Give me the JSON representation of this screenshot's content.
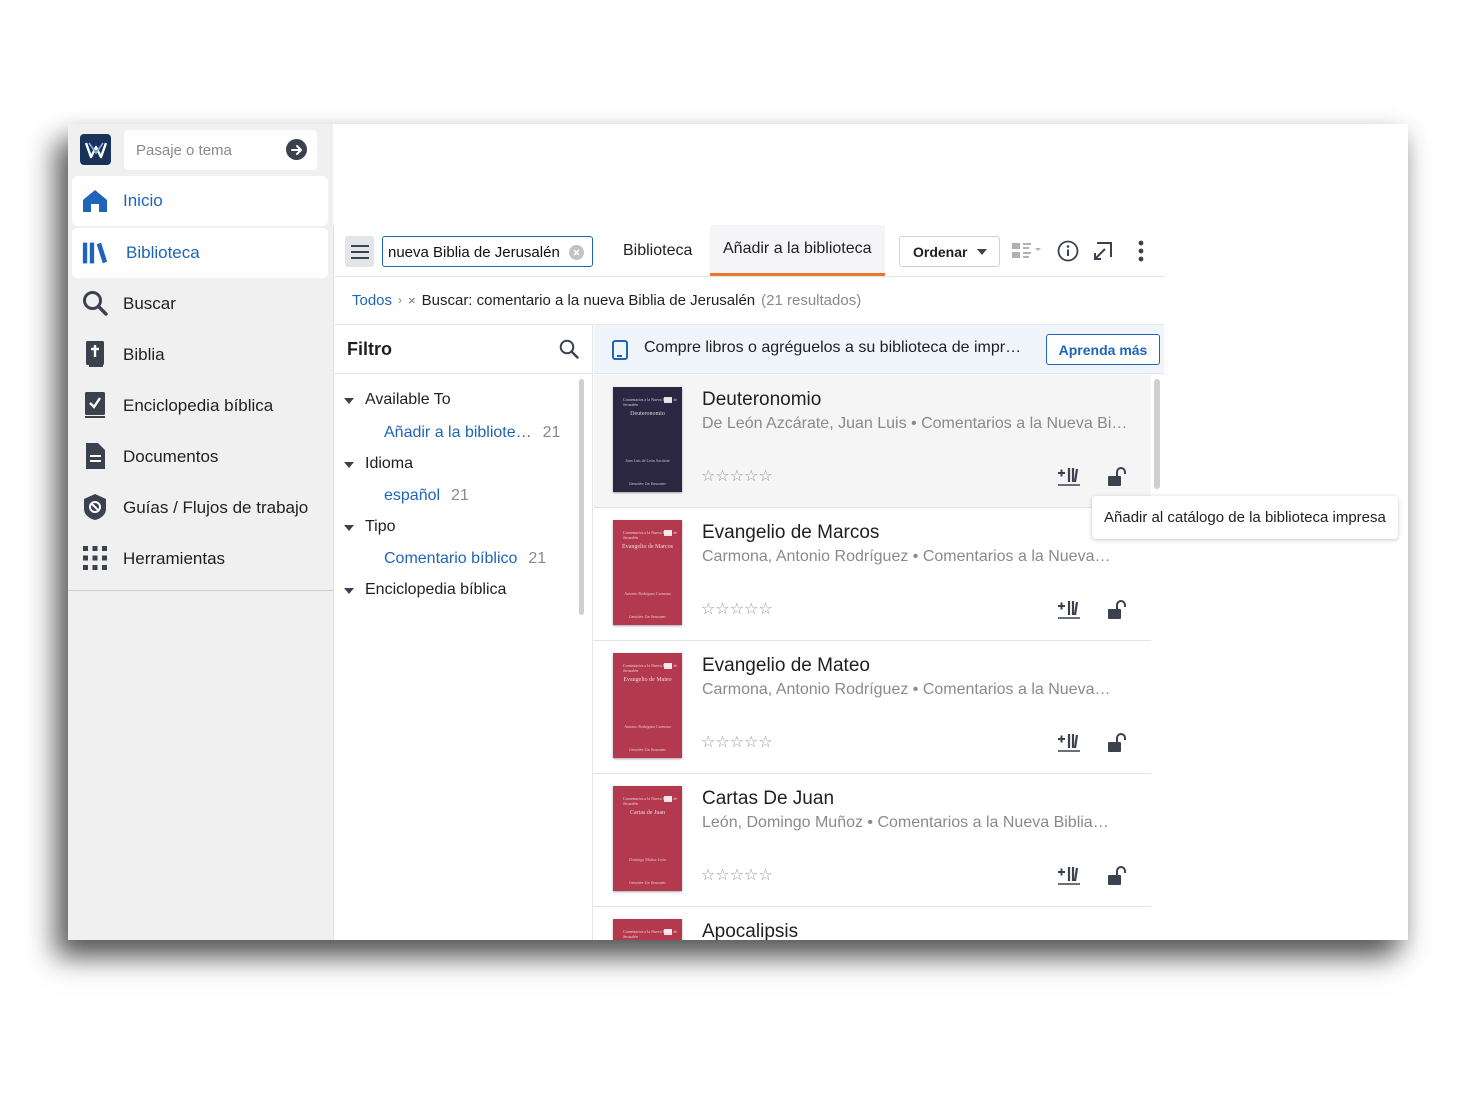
{
  "sidebar": {
    "passage_placeholder": "Pasaje o tema",
    "items": [
      {
        "label": "Inicio",
        "icon": "home-icon",
        "active": true
      },
      {
        "label": "Biblioteca",
        "icon": "library-icon",
        "active": true
      },
      {
        "label": "Buscar",
        "icon": "search-icon"
      },
      {
        "label": "Biblia",
        "icon": "bible-icon"
      },
      {
        "label": "Enciclopedia bíblica",
        "icon": "encyclopedia-icon"
      },
      {
        "label": "Documentos",
        "icon": "document-icon"
      },
      {
        "label": "Guías / Flujos de trabajo",
        "icon": "guides-icon"
      },
      {
        "label": "Herramientas",
        "icon": "tools-grid-icon"
      }
    ]
  },
  "toolbar": {
    "search_value": "nueva Biblia de Jerusalén",
    "tabs": [
      {
        "label": "Biblioteca"
      },
      {
        "label": "Añadir a la biblioteca",
        "active": true
      }
    ],
    "sort_label": "Ordenar"
  },
  "breadcrumb": {
    "root": "Todos",
    "current": "Buscar: comentario a la nueva Biblia de Jerusalén",
    "count": "(21 resultados)"
  },
  "filter": {
    "title": "Filtro",
    "groups": [
      {
        "label": "Available To",
        "items": [
          {
            "label": "Añadir a la bibliote…",
            "count": "21"
          }
        ]
      },
      {
        "label": "Idioma",
        "items": [
          {
            "label": "español",
            "count": "21"
          }
        ]
      },
      {
        "label": "Tipo",
        "items": [
          {
            "label": "Comentario bíblico",
            "count": "21"
          }
        ]
      },
      {
        "label": "Enciclopedia bíblica",
        "items": []
      }
    ]
  },
  "promo": {
    "text": "Compre libros o agréguelos a su biblioteca de impr…",
    "button": "Aprenda más"
  },
  "results": [
    {
      "title": "Deuteronomio",
      "subtitle": "De León Azcárate, Juan Luis • Comentarios a la Nueva Bi…",
      "rating": "☆☆☆☆☆",
      "cover_color": "#2b2743",
      "cover_top": "Comentarios a la Nueva Biblia de Jerusalén",
      "cover_name": "Deuteronomio",
      "cover_author": "Juan Luis de León Azcárate",
      "cover_publisher": "Desclée De Brouwer"
    },
    {
      "title": "Evangelio de Marcos",
      "subtitle": "Carmona, Antonio Rodríguez • Comentarios a la Nueva…",
      "rating": "☆☆☆☆☆",
      "cover_color": "#b3394e",
      "cover_top": "Comentarios a la Nueva Biblia de Jerusalén",
      "cover_name": "Evangelio de Marcos",
      "cover_author": "Antonio Rodríguez Carmona",
      "cover_publisher": "Desclée De Brouwer"
    },
    {
      "title": "Evangelio de Mateo",
      "subtitle": "Carmona, Antonio Rodríguez • Comentarios a la Nueva…",
      "rating": "☆☆☆☆☆",
      "cover_color": "#b3394e",
      "cover_top": "Comentarios a la Nueva Biblia de Jerusalén",
      "cover_name": "Evangelio de Mateo",
      "cover_author": "Antonio Rodríguez Carmona",
      "cover_publisher": "Desclée De Brouwer"
    },
    {
      "title": "Cartas De Juan",
      "subtitle": "León, Domingo Muñoz • Comentarios a la Nueva Biblia…",
      "rating": "☆☆☆☆☆",
      "cover_color": "#b3394e",
      "cover_top": "Comentarios a la Nueva Biblia de Jerusalén",
      "cover_name": "Cartas de Juan",
      "cover_author": "Domingo Muñoz León",
      "cover_publisher": "Desclée De Brouwer"
    },
    {
      "title": "Apocalipsis",
      "subtitle": "",
      "rating": "",
      "cover_color": "#b3394e",
      "cover_top": "Comentarios a la Nueva Biblia de Jerusalén",
      "cover_name": "",
      "cover_author": "",
      "cover_publisher": ""
    }
  ],
  "tooltip": "Añadir al catálogo de la biblioteca impresa",
  "colors": {
    "accent": "#1f64b8",
    "tab_underline": "#e8772e",
    "sidebar_bg": "#f0f0f1"
  }
}
